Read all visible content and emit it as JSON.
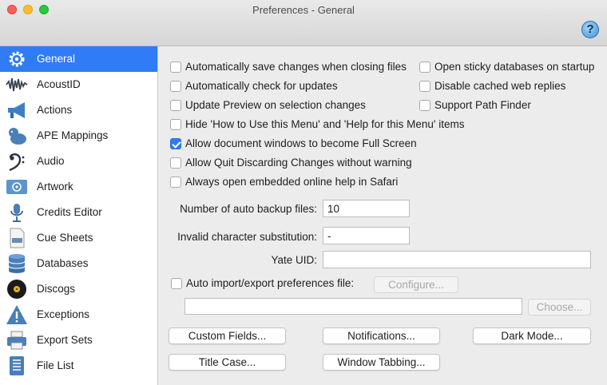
{
  "window": {
    "title": "Preferences - General"
  },
  "colors": {
    "accent": "#2f7cf6",
    "window_bg": "#ececec",
    "sidebar_bg": "#ffffff"
  },
  "sidebar": {
    "items": [
      {
        "label": "General",
        "icon": "gear-icon",
        "selected": true
      },
      {
        "label": "AcoustID",
        "icon": "waveform-icon"
      },
      {
        "label": "Actions",
        "icon": "megaphone-icon"
      },
      {
        "label": "APE Mappings",
        "icon": "gorilla-icon"
      },
      {
        "label": "Audio",
        "icon": "bass-clef-icon"
      },
      {
        "label": "Artwork",
        "icon": "artwork-icon"
      },
      {
        "label": "Credits Editor",
        "icon": "microphone-icon"
      },
      {
        "label": "Cue Sheets",
        "icon": "cue-file-icon"
      },
      {
        "label": "Databases",
        "icon": "database-icon"
      },
      {
        "label": "Discogs",
        "icon": "vinyl-record-icon"
      },
      {
        "label": "Exceptions",
        "icon": "warning-icon"
      },
      {
        "label": "Export Sets",
        "icon": "printer-icon"
      },
      {
        "label": "File List",
        "icon": "file-list-icon"
      }
    ]
  },
  "options": {
    "auto_save": {
      "label": "Automatically save changes when closing files",
      "checked": false
    },
    "auto_update": {
      "label": "Automatically check for updates",
      "checked": false
    },
    "update_preview": {
      "label": "Update Preview on selection changes",
      "checked": false
    },
    "hide_help": {
      "label": "Hide 'How to Use this Menu' and 'Help for this Menu' items",
      "checked": false
    },
    "full_screen": {
      "label": "Allow document windows to become Full Screen",
      "checked": true
    },
    "allow_quit": {
      "label": "Allow Quit Discarding Changes without warning",
      "checked": false
    },
    "always_help": {
      "label": "Always open embedded online help in Safari",
      "checked": false
    },
    "sticky_db": {
      "label": "Open sticky databases on startup",
      "checked": false
    },
    "disable_cache": {
      "label": "Disable cached web replies",
      "checked": false
    },
    "path_finder": {
      "label": "Support Path Finder",
      "checked": false
    }
  },
  "fields": {
    "backup": {
      "label": "Number of auto backup files:",
      "value": "10"
    },
    "invalid": {
      "label": "Invalid character substitution:",
      "value": "-"
    },
    "yate_uid": {
      "label": "Yate UID:",
      "value": ""
    }
  },
  "auto_import": {
    "label": "Auto import/export preferences file:",
    "checked": false,
    "configure": "Configure...",
    "path": "",
    "choose": "Choose..."
  },
  "buttons": {
    "custom_fields": "Custom Fields...",
    "notifications": "Notifications...",
    "dark_mode": "Dark Mode...",
    "title_case": "Title Case...",
    "window_tabbing": "Window Tabbing..."
  }
}
